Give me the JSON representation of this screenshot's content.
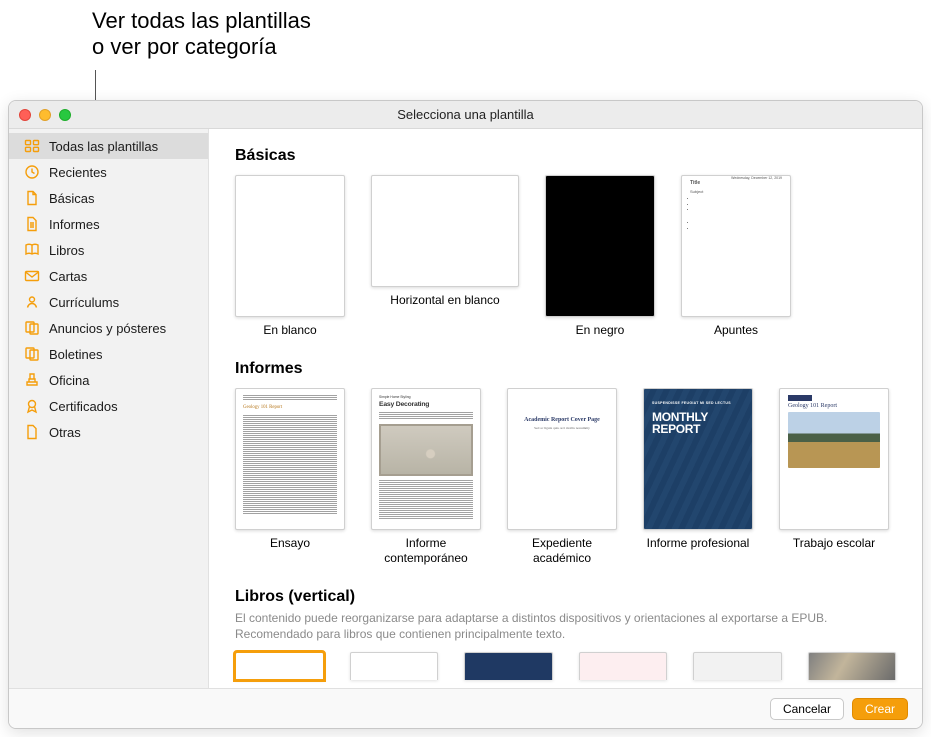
{
  "callout": {
    "line1": "Ver todas las plantillas",
    "line2": "o ver por categoría"
  },
  "window": {
    "title": "Selecciona una plantilla"
  },
  "sidebar": {
    "items": [
      {
        "key": "all",
        "label": "Todas las plantillas",
        "icon": "grid",
        "selected": true
      },
      {
        "key": "recent",
        "label": "Recientes",
        "icon": "clock",
        "selected": false
      },
      {
        "key": "basic",
        "label": "Básicas",
        "icon": "doc",
        "selected": false
      },
      {
        "key": "reports",
        "label": "Informes",
        "icon": "doc-lines",
        "selected": false
      },
      {
        "key": "books",
        "label": "Libros",
        "icon": "book",
        "selected": false
      },
      {
        "key": "letters",
        "label": "Cartas",
        "icon": "envelope",
        "selected": false
      },
      {
        "key": "resumes",
        "label": "Currículums",
        "icon": "person",
        "selected": false
      },
      {
        "key": "posters",
        "label": "Anuncios y pósteres",
        "icon": "pages",
        "selected": false
      },
      {
        "key": "newsletters",
        "label": "Boletines",
        "icon": "pages",
        "selected": false
      },
      {
        "key": "office",
        "label": "Oficina",
        "icon": "stamp",
        "selected": false
      },
      {
        "key": "certs",
        "label": "Certificados",
        "icon": "ribbon",
        "selected": false
      },
      {
        "key": "other",
        "label": "Otras",
        "icon": "doc",
        "selected": false
      }
    ]
  },
  "sections": {
    "basic": {
      "title": "Básicas",
      "templates": [
        {
          "key": "blank",
          "label": "En blanco"
        },
        {
          "key": "blank-land",
          "label": "Horizontal en blanco"
        },
        {
          "key": "black",
          "label": "En negro"
        },
        {
          "key": "notes",
          "label": "Apuntes"
        }
      ]
    },
    "reports": {
      "title": "Informes",
      "templates": [
        {
          "key": "essay",
          "label": "Ensayo"
        },
        {
          "key": "contemp",
          "label": "Informe contemporáneo"
        },
        {
          "key": "academic",
          "label": "Expediente académico"
        },
        {
          "key": "monthly",
          "label": "Informe profesional"
        },
        {
          "key": "school",
          "label": "Trabajo escolar"
        }
      ]
    },
    "books": {
      "title": "Libros (vertical)",
      "description": "El contenido puede reorganizarse para adaptarse a distintos dispositivos y orientaciones al exportarse a EPUB. Recomendado para libros que contienen principalmente texto."
    }
  },
  "thumb_text": {
    "notes": {
      "title": "Title",
      "subject": "Subject",
      "date": "Wednesday, December 12, 2019"
    },
    "essay": {
      "heading": "Geology 101 Report"
    },
    "contemp": {
      "kicker": "Simple Home Styling",
      "heading": "Easy Decorating"
    },
    "academic": {
      "heading": "Academic Report Cover Page",
      "sub": "Sed ac ligula quis orci mollis nonummy"
    },
    "monthly": {
      "kicker": "SUSPENDISSE FEUGIAT MI SED LECTUS",
      "heading1": "MONTHLY",
      "heading2": "REPORT"
    },
    "school": {
      "heading": "Geology 101 Report"
    }
  },
  "buttons": {
    "cancel": "Cancelar",
    "create": "Crear"
  }
}
